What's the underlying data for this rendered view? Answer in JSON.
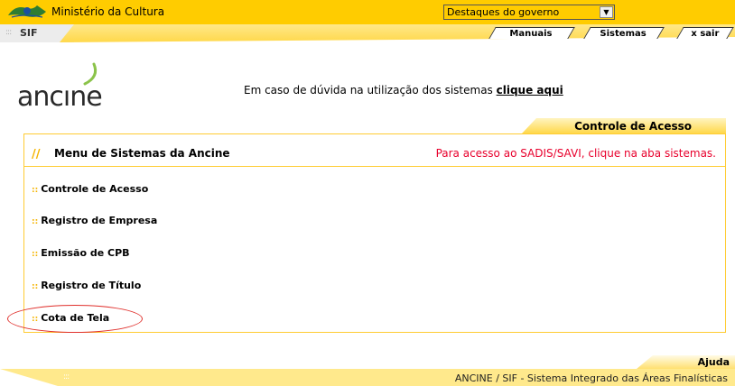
{
  "gov_bar": {
    "title": "Ministério da Cultura",
    "select_value": "Destaques do governo",
    "dropdown_glyph": "▼",
    "logo_icon": "brazil-gov-icon"
  },
  "sif_bar": {
    "dots": ":::",
    "label": "SIF",
    "tabs": [
      "Manuais",
      "Sistemas",
      "x sair"
    ]
  },
  "brand": {
    "logo_text": "ancıne"
  },
  "help": {
    "text": "Em caso de dúvida na utilização dos sistemas ",
    "link": "clique aqui"
  },
  "access_tab": {
    "label": "Controle de Acesso"
  },
  "panel": {
    "slashes": "//",
    "title": "Menu de Sistemas da Ancine",
    "note": "Para acesso ao SADIS/SAVI, clique na aba sistemas.",
    "bullet": "::",
    "items": [
      "Controle de Acesso",
      "Registro de Empresa",
      "Emissão de CPB",
      "Registro de Título",
      "Cota de Tela"
    ]
  },
  "footer": {
    "help_tab": "Ajuda",
    "dots": ":::",
    "text": "ANCINE / SIF - Sistema Integrado das Áreas Finalísticas"
  },
  "colors": {
    "gold": "#ffcc00",
    "note_red": "#e8002c",
    "circle_red": "#e0302c"
  }
}
